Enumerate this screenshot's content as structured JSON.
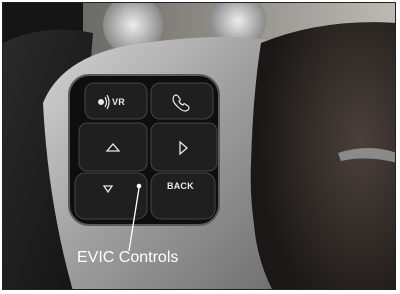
{
  "buttons": {
    "vr_label": "VR",
    "phone_icon": "phone-icon",
    "up_icon": "arrow-up-icon",
    "right_icon": "arrow-right-icon",
    "down_icon": "arrow-down-icon",
    "back_label": "BACK"
  },
  "callout": {
    "label": "EVIC Controls"
  },
  "colors": {
    "trim": "#a8a8a8",
    "button": "#1a1a1a",
    "leather": "#3a3330",
    "caption": "#ffffff"
  }
}
